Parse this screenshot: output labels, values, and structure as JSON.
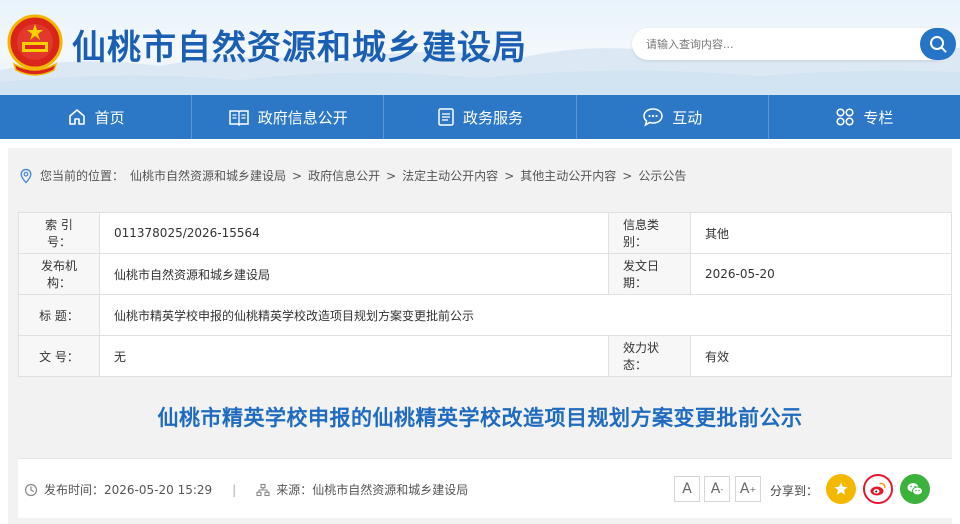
{
  "header": {
    "site_title": "仙桃市自然资源和城乡建设局",
    "search_placeholder": "请输入查询内容..."
  },
  "nav": [
    {
      "label": "首页",
      "icon": "home-icon"
    },
    {
      "label": "政府信息公开",
      "icon": "book-icon"
    },
    {
      "label": "政务服务",
      "icon": "document-icon"
    },
    {
      "label": "互动",
      "icon": "chat-icon"
    },
    {
      "label": "专栏",
      "icon": "grid-icon"
    }
  ],
  "breadcrumb": {
    "prefix": "您当前的位置：",
    "items": [
      "仙桃市自然资源和城乡建设局",
      "政府信息公开",
      "法定主动公开内容",
      "其他主动公开内容",
      "公示公告"
    ],
    "separator": ">"
  },
  "info": {
    "index_label": "索 引 号：",
    "index_value": "011378025/2026-15564",
    "category_label": "信息类别：",
    "category_value": "其他",
    "publisher_label": "发布机构：",
    "publisher_value": "仙桃市自然资源和城乡建设局",
    "date_label": "发文日期：",
    "date_value": "2026-05-20",
    "title_label": "标    题：",
    "title_value": "仙桃市精英学校申报的仙桃精英学校改造项目规划方案变更批前公示",
    "docno_label": "文    号：",
    "docno_value": "无",
    "status_label": "效力状态：",
    "status_value": "有效"
  },
  "article": {
    "title": "仙桃市精英学校申报的仙桃精英学校改造项目规划方案变更批前公示",
    "publish_time_label": "发布时间：",
    "publish_time": "2026-05-20 15:29",
    "source_label": "来源：",
    "source": "仙桃市自然资源和城乡建设局",
    "font_sizes": [
      "A",
      "A",
      "A"
    ],
    "share_label": "分享到："
  },
  "colors": {
    "brand": "#1a5fb4",
    "nav": "#2d78c6",
    "share_star": "#f5b800",
    "share_weibo": "#e6162d",
    "share_wechat": "#3bb23b"
  }
}
